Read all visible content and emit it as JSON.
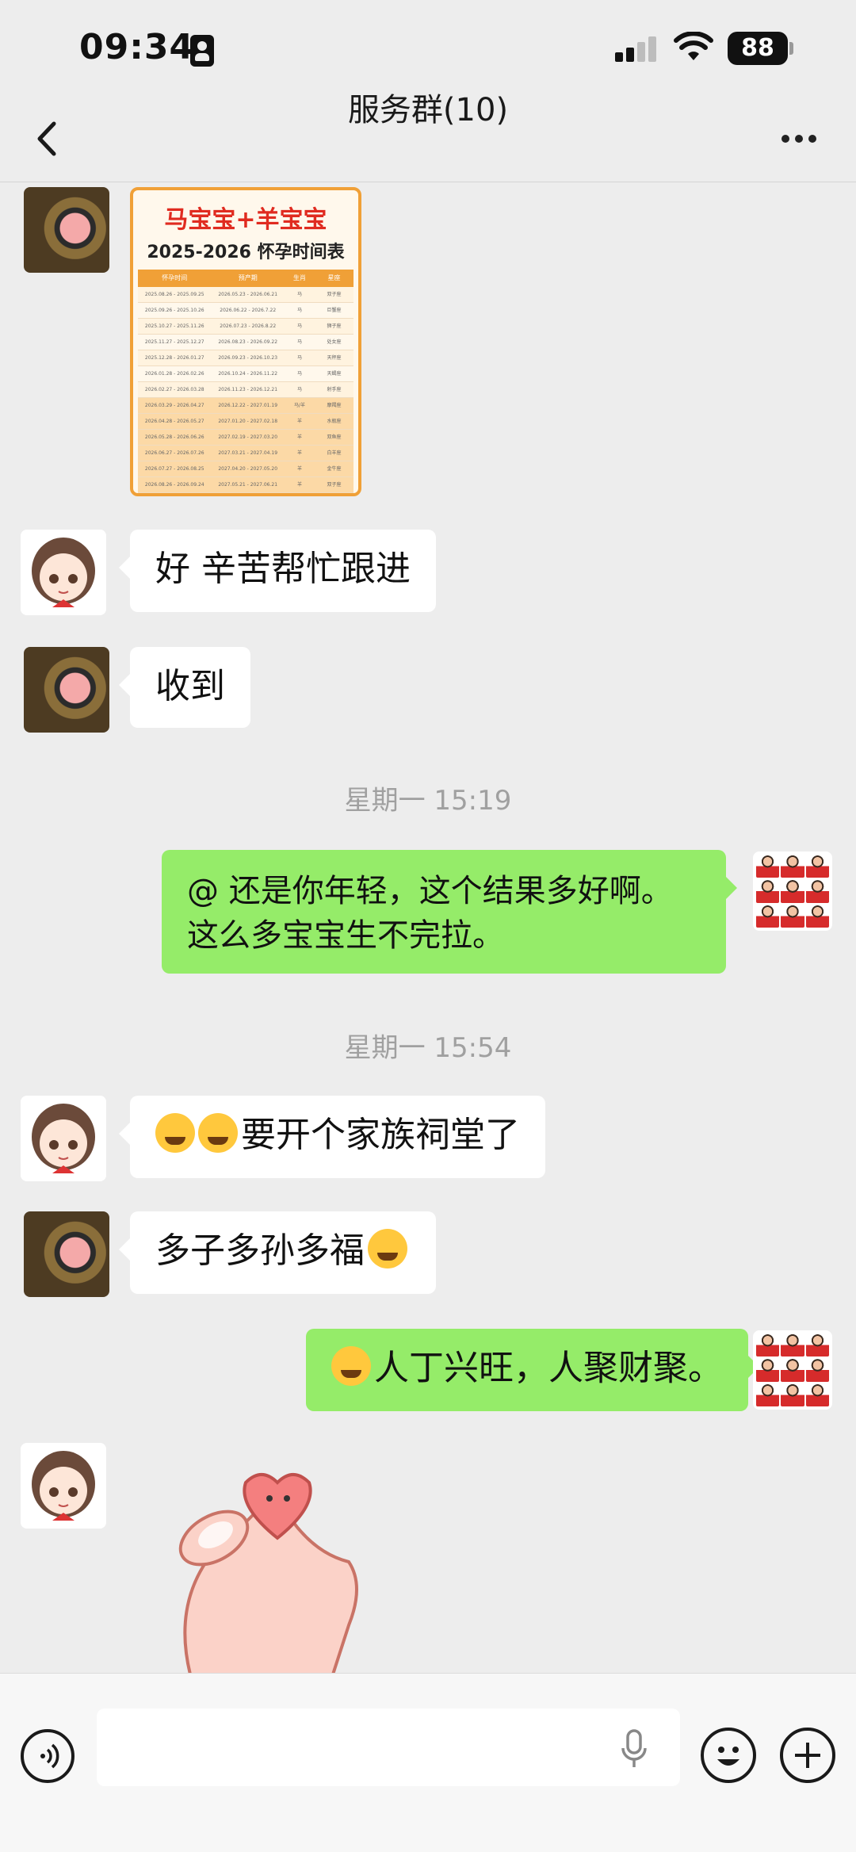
{
  "status_bar": {
    "time": "09:34",
    "battery": "88"
  },
  "header": {
    "title": "服务群(10)"
  },
  "image_message": {
    "title_line1": "马宝宝+羊宝宝",
    "title_line2": "2025-2026 怀孕时间表",
    "columns": [
      "怀孕时间",
      "预产期",
      "生肖",
      "星座"
    ],
    "rows": [
      [
        "2025.08.26 - 2025.09.25",
        "2026.05.23 - 2026.06.21",
        "马",
        "双子座"
      ],
      [
        "2025.09.26 - 2025.10.26",
        "2026.06.22 - 2026.7.22",
        "马",
        "巨蟹座"
      ],
      [
        "2025.10.27 - 2025.11.26",
        "2026.07.23 - 2026.8.22",
        "马",
        "狮子座"
      ],
      [
        "2025.11.27 - 2025.12.27",
        "2026.08.23 - 2026.09.22",
        "马",
        "处女座"
      ],
      [
        "2025.12.28 - 2026.01.27",
        "2026.09.23 - 2026.10.23",
        "马",
        "天秤座"
      ],
      [
        "2026.01.28 - 2026.02.26",
        "2026.10.24 - 2026.11.22",
        "马",
        "天蝎座"
      ],
      [
        "2026.02.27 - 2026.03.28",
        "2026.11.23 - 2026.12.21",
        "马",
        "射手座"
      ],
      [
        "2026.03.29 - 2026.04.27",
        "2026.12.22 - 2027.01.19",
        "马/羊",
        "摩羯座"
      ],
      [
        "2026.04.28 - 2026.05.27",
        "2027.01.20 - 2027.02.18",
        "羊",
        "水瓶座"
      ],
      [
        "2026.05.28 - 2026.06.26",
        "2027.02.19 - 2027.03.20",
        "羊",
        "双鱼座"
      ],
      [
        "2026.06.27 - 2026.07.26",
        "2027.03.21 - 2027.04.19",
        "羊",
        "白羊座"
      ],
      [
        "2026.07.27 - 2026.08.25",
        "2027.04.20 - 2027.05.20",
        "羊",
        "金牛座"
      ],
      [
        "2026.08.26 - 2026.09.24",
        "2027.05.21 - 2027.06.21",
        "羊",
        "双子座"
      ]
    ]
  },
  "messages": {
    "m1": "好 辛苦帮忙跟进",
    "m2": "收到",
    "ts1": "星期一 15:19",
    "m3": "@        还是你年轻，这个结果多好啊。这么多宝宝生不完拉。",
    "ts2": "星期一 15:54",
    "m4": "要开个家族祠堂了",
    "m5": "多子多孙多福",
    "m6": "人丁兴旺，人聚财聚。"
  },
  "input": {
    "placeholder": ""
  },
  "icons": {
    "back": "back-icon",
    "more": "more-icon",
    "voice": "voice-icon",
    "mic": "mic-icon",
    "emoji": "emoji-icon",
    "plus": "plus-icon"
  },
  "colors": {
    "background": "#ededed",
    "own_bubble": "#95ec69",
    "other_bubble": "#ffffff",
    "table_accent": "#f0a037"
  }
}
